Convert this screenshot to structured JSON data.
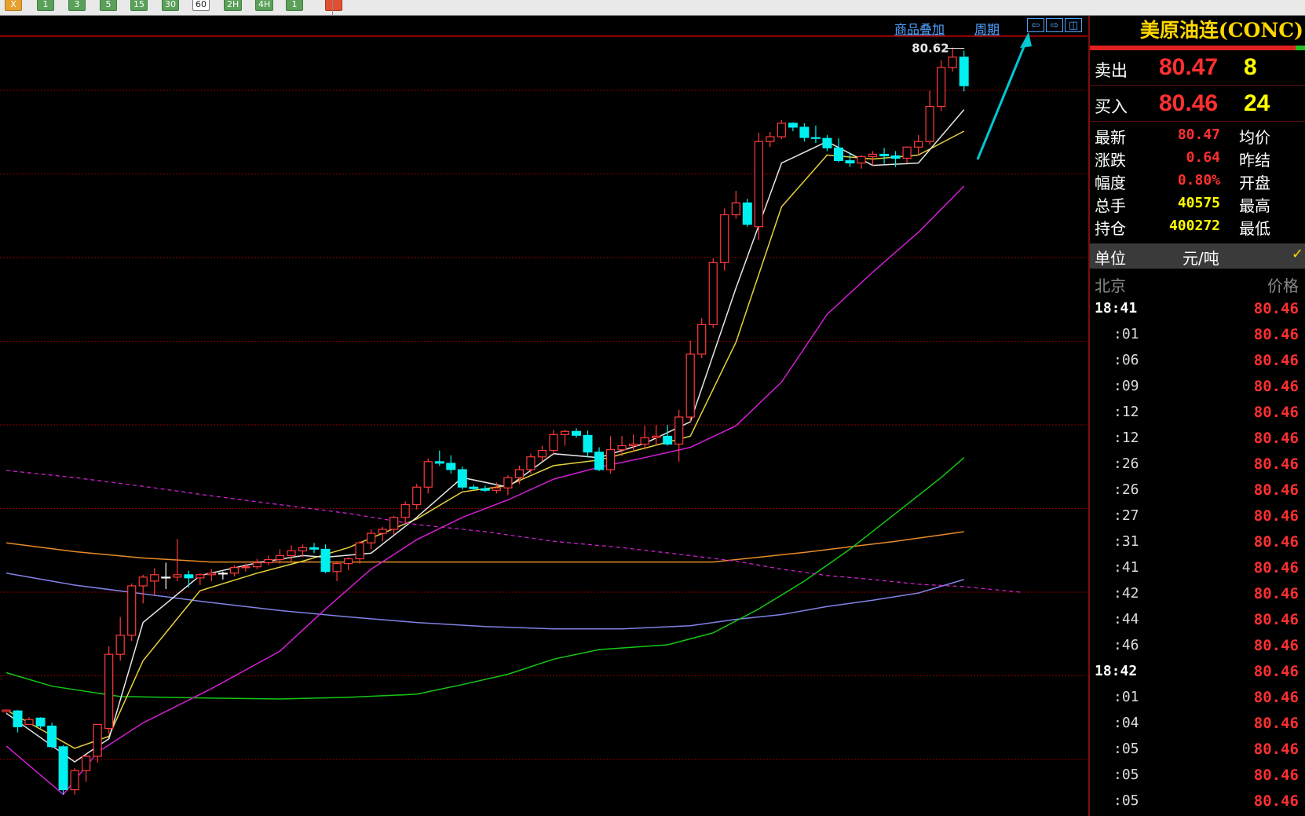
{
  "toolbar": {
    "buttons": [
      {
        "label": "X",
        "style": "first"
      },
      {
        "label": "1",
        "style": "normal"
      },
      {
        "label": "3",
        "style": "normal"
      },
      {
        "label": "5",
        "style": "normal"
      },
      {
        "label": "15",
        "style": "normal"
      },
      {
        "label": "30",
        "style": "normal"
      },
      {
        "label": "60",
        "style": "active"
      },
      {
        "label": "2H",
        "style": "normal"
      },
      {
        "label": "4H",
        "style": "normal"
      },
      {
        "label": "1",
        "style": "normal"
      },
      {
        "label": "",
        "style": "last"
      }
    ]
  },
  "chart_header": {
    "overlay_link": "商品叠加",
    "period_link": "周期",
    "nav_buttons": [
      "⇦",
      "⇨",
      "◫"
    ]
  },
  "chart_data": {
    "type": "candlestick",
    "price_label": "80.62",
    "colors": {
      "up": "#ff3a3a",
      "down": "#00f0f0",
      "grid": "#8b0000",
      "ma5": "#e6e6e6",
      "ma10": "#e6d23c",
      "ma20": "#d21ed2",
      "ma60": "#14c814",
      "ma120": "#e68c28",
      "ma250": "#8282e6",
      "dashed": "#d21ed2",
      "arrow": "#00c8d2"
    },
    "candles": [
      [
        79.26,
        79.29,
        79.25,
        79.28
      ],
      [
        79.27,
        79.28,
        79.0,
        79.07
      ],
      [
        79.1,
        79.19,
        79.14,
        79.16
      ],
      [
        79.18,
        79.19,
        79.05,
        79.08
      ],
      [
        79.08,
        79.12,
        78.8,
        78.82
      ],
      [
        78.82,
        78.84,
        78.22,
        78.28
      ],
      [
        78.28,
        78.55,
        78.22,
        78.52
      ],
      [
        78.52,
        78.72,
        78.38,
        78.7
      ],
      [
        78.7,
        79.1,
        78.62,
        79.1
      ],
      [
        79.05,
        80.08,
        78.98,
        79.98
      ],
      [
        79.98,
        80.45,
        79.9,
        80.22
      ],
      [
        80.22,
        80.87,
        80.15,
        80.84
      ],
      [
        80.84,
        80.98,
        80.62,
        80.95
      ],
      [
        80.9,
        81.06,
        80.72,
        80.98
      ],
      [
        80.95,
        81.13,
        80.8,
        80.95
      ],
      [
        80.95,
        81.43,
        80.9,
        80.98
      ],
      [
        80.98,
        81.03,
        80.82,
        80.94
      ],
      [
        80.94,
        81.0,
        80.85,
        80.98
      ],
      [
        80.98,
        81.05,
        80.9,
        81.0
      ],
      [
        81.0,
        81.02,
        80.92,
        81.0
      ],
      [
        81.0,
        81.1,
        80.96,
        81.07
      ],
      [
        81.07,
        81.12,
        81.02,
        81.08
      ],
      [
        81.08,
        81.18,
        81.05,
        81.13
      ],
      [
        81.13,
        81.22,
        81.1,
        81.17
      ],
      [
        81.17,
        81.3,
        81.12,
        81.22
      ],
      [
        81.22,
        81.35,
        81.15,
        81.28
      ],
      [
        81.28,
        81.36,
        81.2,
        81.32
      ],
      [
        81.32,
        81.38,
        81.25,
        81.3
      ],
      [
        81.3,
        81.36,
        81.0,
        81.02
      ],
      [
        81.02,
        81.15,
        80.9,
        81.12
      ],
      [
        81.12,
        81.2,
        81.04,
        81.18
      ],
      [
        81.18,
        81.4,
        81.12,
        81.38
      ],
      [
        81.38,
        81.55,
        81.3,
        81.5
      ],
      [
        81.5,
        81.58,
        81.4,
        81.55
      ],
      [
        81.55,
        81.72,
        81.48,
        81.7
      ],
      [
        81.7,
        81.9,
        81.62,
        81.86
      ],
      [
        81.86,
        82.12,
        81.8,
        82.08
      ],
      [
        82.08,
        82.44,
        82.0,
        82.4
      ],
      [
        82.4,
        82.54,
        82.35,
        82.38
      ],
      [
        82.38,
        82.48,
        82.25,
        82.3
      ],
      [
        82.3,
        82.34,
        82.05,
        82.08
      ],
      [
        82.08,
        82.11,
        82.04,
        82.06
      ],
      [
        82.06,
        82.1,
        82.02,
        82.04
      ],
      [
        82.04,
        82.14,
        82.0,
        82.07
      ],
      [
        82.07,
        82.23,
        81.98,
        82.2
      ],
      [
        82.2,
        82.35,
        82.12,
        82.3
      ],
      [
        82.3,
        82.5,
        82.25,
        82.46
      ],
      [
        82.46,
        82.6,
        82.4,
        82.54
      ],
      [
        82.54,
        82.8,
        82.48,
        82.74
      ],
      [
        82.74,
        82.8,
        82.6,
        82.78
      ],
      [
        82.78,
        82.82,
        82.7,
        82.73
      ],
      [
        82.73,
        82.79,
        82.45,
        82.52
      ],
      [
        82.52,
        82.58,
        82.28,
        82.3
      ],
      [
        82.3,
        82.72,
        82.25,
        82.55
      ],
      [
        82.55,
        82.72,
        82.47,
        82.6
      ],
      [
        82.6,
        82.74,
        82.52,
        82.62
      ],
      [
        82.62,
        82.85,
        82.55,
        82.7
      ],
      [
        82.7,
        82.86,
        82.6,
        82.72
      ],
      [
        82.72,
        82.86,
        82.6,
        82.62
      ],
      [
        82.62,
        83.05,
        82.4,
        82.96
      ],
      [
        82.96,
        83.92,
        82.9,
        83.75
      ],
      [
        83.75,
        84.2,
        83.7,
        84.12
      ],
      [
        84.12,
        84.95,
        84.08,
        84.9
      ],
      [
        84.9,
        85.58,
        84.8,
        85.5
      ],
      [
        85.5,
        85.8,
        85.45,
        85.65
      ],
      [
        85.65,
        85.7,
        85.35,
        85.38
      ],
      [
        85.35,
        86.53,
        85.18,
        86.42
      ],
      [
        86.42,
        86.54,
        86.35,
        86.48
      ],
      [
        86.48,
        86.69,
        86.45,
        86.65
      ],
      [
        86.65,
        86.66,
        86.55,
        86.6
      ],
      [
        86.6,
        86.65,
        86.42,
        86.47
      ],
      [
        86.47,
        86.62,
        86.4,
        86.46
      ],
      [
        86.46,
        86.5,
        86.3,
        86.34
      ],
      [
        86.34,
        86.46,
        86.16,
        86.18
      ],
      [
        86.18,
        86.28,
        86.1,
        86.15
      ],
      [
        86.15,
        86.25,
        86.08,
        86.23
      ],
      [
        86.23,
        86.3,
        86.12,
        86.26
      ],
      [
        86.26,
        86.34,
        86.14,
        86.24
      ],
      [
        86.24,
        86.3,
        86.1,
        86.21
      ],
      [
        86.21,
        86.36,
        86.15,
        86.35
      ],
      [
        86.35,
        86.5,
        86.25,
        86.42
      ],
      [
        86.42,
        87.06,
        86.38,
        86.86
      ],
      [
        86.86,
        87.44,
        86.8,
        87.35
      ],
      [
        87.35,
        87.6,
        87.3,
        87.48
      ],
      [
        87.48,
        87.56,
        87.05,
        87.12
      ]
    ],
    "ma_lines": {
      "ma5": [
        [
          0,
          79.24
        ],
        [
          6,
          78.63
        ],
        [
          9,
          78.92
        ],
        [
          12,
          80.38
        ],
        [
          17,
          80.97
        ],
        [
          22,
          81.13
        ],
        [
          26,
          81.22
        ],
        [
          28,
          81.2
        ],
        [
          32,
          81.25
        ],
        [
          36,
          81.7
        ],
        [
          40,
          82.2
        ],
        [
          44,
          82.08
        ],
        [
          48,
          82.5
        ],
        [
          52,
          82.45
        ],
        [
          56,
          82.63
        ],
        [
          60,
          82.9
        ],
        [
          64,
          84.58
        ],
        [
          68,
          86.15
        ],
        [
          72,
          86.42
        ],
        [
          76,
          86.12
        ],
        [
          80,
          86.15
        ],
        [
          84,
          86.82
        ]
      ],
      "ma10": [
        [
          0,
          79.28
        ],
        [
          6,
          78.8
        ],
        [
          9,
          78.95
        ],
        [
          12,
          79.9
        ],
        [
          17,
          80.78
        ],
        [
          22,
          81.0
        ],
        [
          26,
          81.15
        ],
        [
          30,
          81.32
        ],
        [
          36,
          81.68
        ],
        [
          40,
          82.02
        ],
        [
          44,
          82.1
        ],
        [
          48,
          82.35
        ],
        [
          52,
          82.42
        ],
        [
          56,
          82.57
        ],
        [
          60,
          82.72
        ],
        [
          64,
          83.9
        ],
        [
          68,
          85.6
        ],
        [
          72,
          86.25
        ],
        [
          76,
          86.2
        ],
        [
          80,
          86.25
        ],
        [
          84,
          86.55
        ]
      ],
      "ma20": [
        [
          0,
          78.83
        ],
        [
          5,
          78.22
        ],
        [
          8,
          78.75
        ],
        [
          12,
          79.12
        ],
        [
          18,
          79.55
        ],
        [
          24,
          80.02
        ],
        [
          28,
          80.55
        ],
        [
          32,
          81.05
        ],
        [
          36,
          81.42
        ],
        [
          40,
          81.7
        ],
        [
          44,
          81.92
        ],
        [
          48,
          82.18
        ],
        [
          52,
          82.33
        ],
        [
          56,
          82.45
        ],
        [
          60,
          82.58
        ],
        [
          64,
          82.85
        ],
        [
          68,
          83.4
        ],
        [
          72,
          84.25
        ],
        [
          76,
          84.78
        ],
        [
          80,
          85.28
        ],
        [
          84,
          85.86
        ]
      ],
      "ma60": [
        [
          0,
          79.75
        ],
        [
          4,
          79.58
        ],
        [
          10,
          79.45
        ],
        [
          18,
          79.43
        ],
        [
          24,
          79.42
        ],
        [
          30,
          79.44
        ],
        [
          36,
          79.48
        ],
        [
          40,
          79.6
        ],
        [
          44,
          79.73
        ],
        [
          48,
          79.92
        ],
        [
          52,
          80.04
        ],
        [
          58,
          80.1
        ],
        [
          62,
          80.25
        ],
        [
          66,
          80.55
        ],
        [
          70,
          80.9
        ],
        [
          74,
          81.3
        ],
        [
          78,
          81.75
        ],
        [
          82,
          82.2
        ],
        [
          84,
          82.45
        ]
      ],
      "ma120": [
        [
          0,
          81.38
        ],
        [
          6,
          81.27
        ],
        [
          12,
          81.19
        ],
        [
          18,
          81.14
        ],
        [
          24,
          81.14
        ],
        [
          30,
          81.14
        ],
        [
          36,
          81.14
        ],
        [
          40,
          81.14
        ],
        [
          48,
          81.14
        ],
        [
          56,
          81.14
        ],
        [
          62,
          81.14
        ],
        [
          66,
          81.2
        ],
        [
          70,
          81.26
        ],
        [
          74,
          81.33
        ],
        [
          78,
          81.4
        ],
        [
          82,
          81.48
        ],
        [
          84,
          81.52
        ]
      ],
      "ma250": [
        [
          0,
          81.0
        ],
        [
          6,
          80.85
        ],
        [
          12,
          80.74
        ],
        [
          18,
          80.63
        ],
        [
          24,
          80.53
        ],
        [
          30,
          80.45
        ],
        [
          36,
          80.38
        ],
        [
          42,
          80.33
        ],
        [
          48,
          80.3
        ],
        [
          54,
          80.3
        ],
        [
          60,
          80.34
        ],
        [
          64,
          80.42
        ],
        [
          68,
          80.48
        ],
        [
          72,
          80.58
        ],
        [
          76,
          80.66
        ],
        [
          80,
          80.75
        ],
        [
          84,
          80.92
        ]
      ],
      "dashed": [
        [
          0,
          82.29
        ],
        [
          6,
          82.2
        ],
        [
          12,
          82.09
        ],
        [
          18,
          81.97
        ],
        [
          24,
          81.86
        ],
        [
          30,
          81.75
        ],
        [
          36,
          81.61
        ],
        [
          42,
          81.52
        ],
        [
          48,
          81.4
        ],
        [
          54,
          81.32
        ],
        [
          60,
          81.22
        ],
        [
          64,
          81.15
        ],
        [
          68,
          81.05
        ],
        [
          72,
          80.97
        ],
        [
          76,
          80.92
        ],
        [
          80,
          80.86
        ],
        [
          84,
          80.83
        ],
        [
          89,
          80.76
        ]
      ]
    }
  },
  "quote_panel": {
    "title": "美原油连(CONC)",
    "sell_label": "卖出",
    "sell_price": "80.47",
    "sell_volume": "8",
    "buy_label": "买入",
    "buy_price": "80.46",
    "buy_volume": "24",
    "stats": [
      {
        "label": "最新",
        "value": "80.47",
        "color": "#ff3030",
        "label2": "均价"
      },
      {
        "label": "涨跌",
        "value": "0.64",
        "color": "#ff3030",
        "label2": "昨结"
      },
      {
        "label": "幅度",
        "value": "0.80%",
        "color": "#ff3030",
        "label2": "开盘"
      },
      {
        "label": "总手",
        "value": "40575",
        "color": "#ffff00",
        "label2": "最高"
      },
      {
        "label": "持仓",
        "value": "400272",
        "color": "#ffff00",
        "label2": "最低"
      }
    ],
    "unit_label": "单位",
    "unit_value": "元/吨",
    "unit_check": "✓",
    "tick_header_time": "北京",
    "tick_header_price": "价格",
    "ticks": [
      {
        "time": "18:41",
        "price": "80.46",
        "full": true
      },
      {
        "time": ":01",
        "price": "80.46",
        "full": false
      },
      {
        "time": ":06",
        "price": "80.46",
        "full": false
      },
      {
        "time": ":09",
        "price": "80.46",
        "full": false
      },
      {
        "time": ":12",
        "price": "80.46",
        "full": false
      },
      {
        "time": ":12",
        "price": "80.46",
        "full": false
      },
      {
        "time": ":26",
        "price": "80.46",
        "full": false
      },
      {
        "time": ":26",
        "price": "80.46",
        "full": false
      },
      {
        "time": ":27",
        "price": "80.46",
        "full": false
      },
      {
        "time": ":31",
        "price": "80.46",
        "full": false
      },
      {
        "time": ":41",
        "price": "80.46",
        "full": false
      },
      {
        "time": ":42",
        "price": "80.46",
        "full": false
      },
      {
        "time": ":44",
        "price": "80.46",
        "full": false
      },
      {
        "time": ":46",
        "price": "80.46",
        "full": false
      },
      {
        "time": "18:42",
        "price": "80.46",
        "full": true
      },
      {
        "time": ":01",
        "price": "80.46",
        "full": false
      },
      {
        "time": ":04",
        "price": "80.46",
        "full": false
      },
      {
        "time": ":05",
        "price": "80.46",
        "full": false
      },
      {
        "time": ":05",
        "price": "80.46",
        "full": false
      },
      {
        "time": ":05",
        "price": "80.46",
        "full": false
      }
    ]
  }
}
